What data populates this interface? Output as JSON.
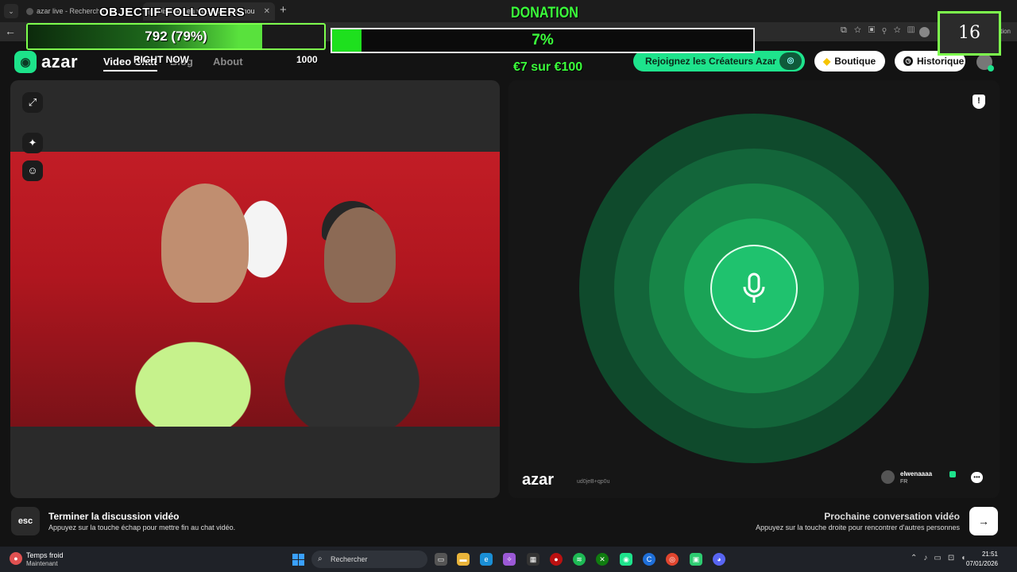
{
  "browser": {
    "tab1_title": "azar live - Recherche",
    "tab2_title": "Discutez en vidéo avec de nou",
    "url_trail": "conversation"
  },
  "header": {
    "logo_text": "azar",
    "nav": [
      "Video Chat",
      "Blog",
      "About"
    ],
    "creators_label": "Rejoignez les Créateurs Azar",
    "boutique_label": "Boutique",
    "historique_label": "Historique"
  },
  "remote": {
    "logo_text": "azar",
    "id_text": "ud0jeB+qp0u",
    "peer_name": "elwenaaaa",
    "peer_country": "FR"
  },
  "bottom": {
    "esc_key": "esc",
    "end_title": "Terminer la discussion vidéo",
    "end_hint": "Appuyez sur la touche échap pour mettre fin au chat vidéo.",
    "next_title": "Prochaine conversation vidéo",
    "next_hint": "Appuyez sur la touche droite pour rencontrer d'autres personnes"
  },
  "taskbar": {
    "weather_title": "Temps froid",
    "weather_sub": "Maintenant",
    "search_label": "Rechercher",
    "time": "21:51",
    "date": "07/01/2026"
  },
  "overlay": {
    "followers_title": "OBJECTIF FOLLOWERS",
    "followers_value": "792 (79%)",
    "followers_progress": 0.79,
    "right_now_label": "RIGHT NOW",
    "target_value": "1000",
    "donation_title": "DONATION",
    "donation_pct": "7%",
    "donation_progress": 0.07,
    "donation_amount": "€7 sur €100",
    "counter": "16"
  },
  "colors": {
    "accent": "#1ee38c",
    "overlay_green": "#3bff3b"
  }
}
